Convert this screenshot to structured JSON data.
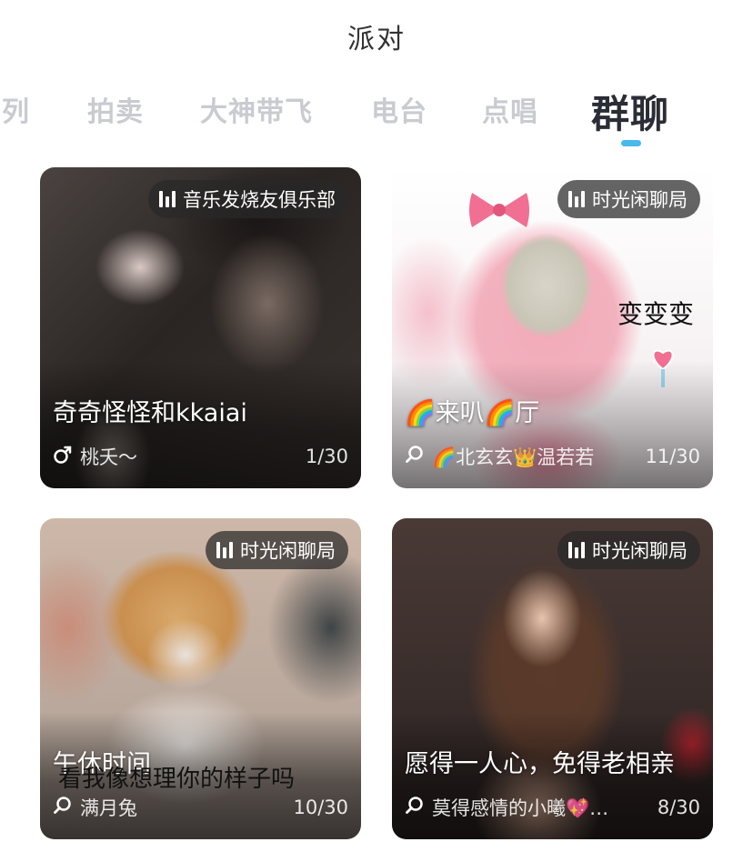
{
  "header": {
    "title": "派对"
  },
  "tabs": [
    {
      "label": "列"
    },
    {
      "label": "拍卖"
    },
    {
      "label": "大神带飞"
    },
    {
      "label": "电台"
    },
    {
      "label": "点唱"
    },
    {
      "label": "群聊",
      "active": true
    }
  ],
  "colors": {
    "tab_active": "#2a2d35",
    "tab_inactive": "#c9cbd1",
    "indicator": "#49b8ea",
    "tag_bg": "#282828"
  },
  "rooms": [
    {
      "tag": "音乐发烧友俱乐部",
      "tag_icon": "sound-bars-icon",
      "name": "奇奇怪怪和kkaiai",
      "host_icon": "male-icon",
      "host": "桃夭～",
      "count": "1/30"
    },
    {
      "tag": "时光闲聊局",
      "tag_icon": "sound-bars-icon",
      "name": "🌈来叭🌈厅",
      "host_icon": "search-icon",
      "host": "🌈北玄玄👑温若若",
      "count": "11/30",
      "overlay_text": "变变变"
    },
    {
      "tag": "时光闲聊局",
      "tag_icon": "sound-bars-icon",
      "name": "午休时间",
      "host_icon": "search-icon",
      "host": "满月兔",
      "count": "10/30",
      "overlay_text": "看我像想理你的样子吗"
    },
    {
      "tag": "时光闲聊局",
      "tag_icon": "sound-bars-icon",
      "name": "愿得一人心，免得老相亲",
      "host_icon": "search-icon",
      "host": "莫得感情的小曦💖…",
      "count": "8/30"
    }
  ]
}
